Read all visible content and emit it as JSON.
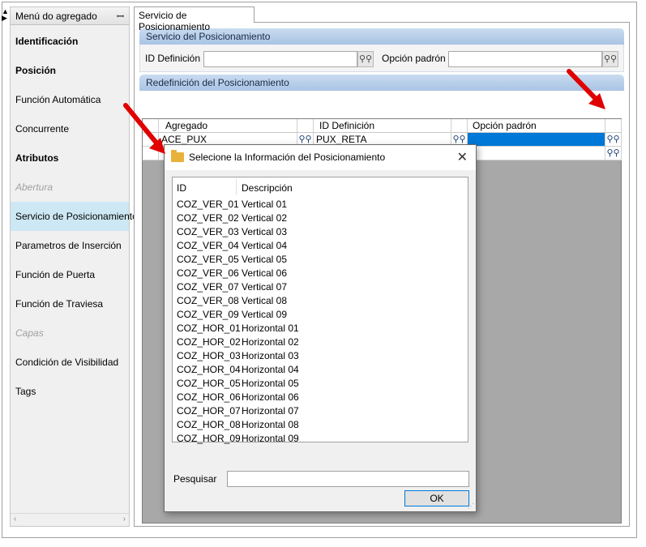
{
  "sidebar": {
    "header": "Menú do agregado",
    "items": [
      {
        "label": "Identificación",
        "style": "bold"
      },
      {
        "label": "Posición",
        "style": "bold"
      },
      {
        "label": "Función Automática",
        "style": "normal"
      },
      {
        "label": "Concurrente",
        "style": "normal"
      },
      {
        "label": "Atributos",
        "style": "bold"
      },
      {
        "label": "Abertura",
        "style": "disabled"
      },
      {
        "label": "Servicio de Posicionamiento",
        "style": "selected"
      },
      {
        "label": "Parametros de Inserción",
        "style": "normal"
      },
      {
        "label": "Función de Puerta",
        "style": "normal"
      },
      {
        "label": "Función de Traviesa",
        "style": "normal"
      },
      {
        "label": "Capas",
        "style": "disabled"
      },
      {
        "label": "Condición de Visibilidad",
        "style": "normal"
      },
      {
        "label": "Tags",
        "style": "normal"
      }
    ]
  },
  "tab": {
    "label": "Servicio de Posicionamiento"
  },
  "group1": {
    "title": "Servicio del Posicionamiento",
    "id_label": "ID Definición",
    "id_value": "",
    "option_label": "Opción padrón",
    "option_value": ""
  },
  "group2": {
    "title": "Redefinición del Posicionamiento",
    "columns": [
      "Agregado",
      "ID Definición",
      "Opción padrón"
    ],
    "rows": [
      {
        "agregado": "ACE_PUX",
        "id_definicion": "PUX_RETA",
        "opcion": ""
      },
      {
        "agregado": "",
        "id_definicion": "",
        "opcion": ""
      }
    ]
  },
  "dialog": {
    "title": "Selecione la Información del Posicionamiento",
    "columns": {
      "id": "ID",
      "desc": "Descripción"
    },
    "rows": [
      {
        "id": "COZ_VER_01",
        "desc": "Vertical 01"
      },
      {
        "id": "COZ_VER_02",
        "desc": "Vertical 02"
      },
      {
        "id": "COZ_VER_03",
        "desc": "Vertical 03"
      },
      {
        "id": "COZ_VER_04",
        "desc": "Vertical 04"
      },
      {
        "id": "COZ_VER_05",
        "desc": "Vertical 05"
      },
      {
        "id": "COZ_VER_06",
        "desc": "Vertical 06"
      },
      {
        "id": "COZ_VER_07",
        "desc": "Vertical 07"
      },
      {
        "id": "COZ_VER_08",
        "desc": "Vertical 08"
      },
      {
        "id": "COZ_VER_09",
        "desc": "Vertical 09"
      },
      {
        "id": "COZ_HOR_01",
        "desc": "Horizontal 01"
      },
      {
        "id": "COZ_HOR_02",
        "desc": "Horizontal 02"
      },
      {
        "id": "COZ_HOR_03",
        "desc": "Horizontal 03"
      },
      {
        "id": "COZ_HOR_04",
        "desc": "Horizontal 04"
      },
      {
        "id": "COZ_HOR_05",
        "desc": "Horizontal 05"
      },
      {
        "id": "COZ_HOR_06",
        "desc": "Horizontal 06"
      },
      {
        "id": "COZ_HOR_07",
        "desc": "Horizontal 07"
      },
      {
        "id": "COZ_HOR_08",
        "desc": "Horizontal 08"
      },
      {
        "id": "COZ_HOR_09",
        "desc": "Horizontal 09"
      }
    ],
    "search_label": "Pesquisar",
    "search_value": "",
    "ok_label": "OK"
  },
  "colors": {
    "selection": "#0078d7",
    "sidebar_selected": "#cde8f4",
    "annotation_arrow": "#e00000"
  },
  "icons": {
    "binoculars": "binoculars-icon",
    "folder": "folder-icon",
    "close": "close-icon",
    "pin": "pin-icon"
  }
}
